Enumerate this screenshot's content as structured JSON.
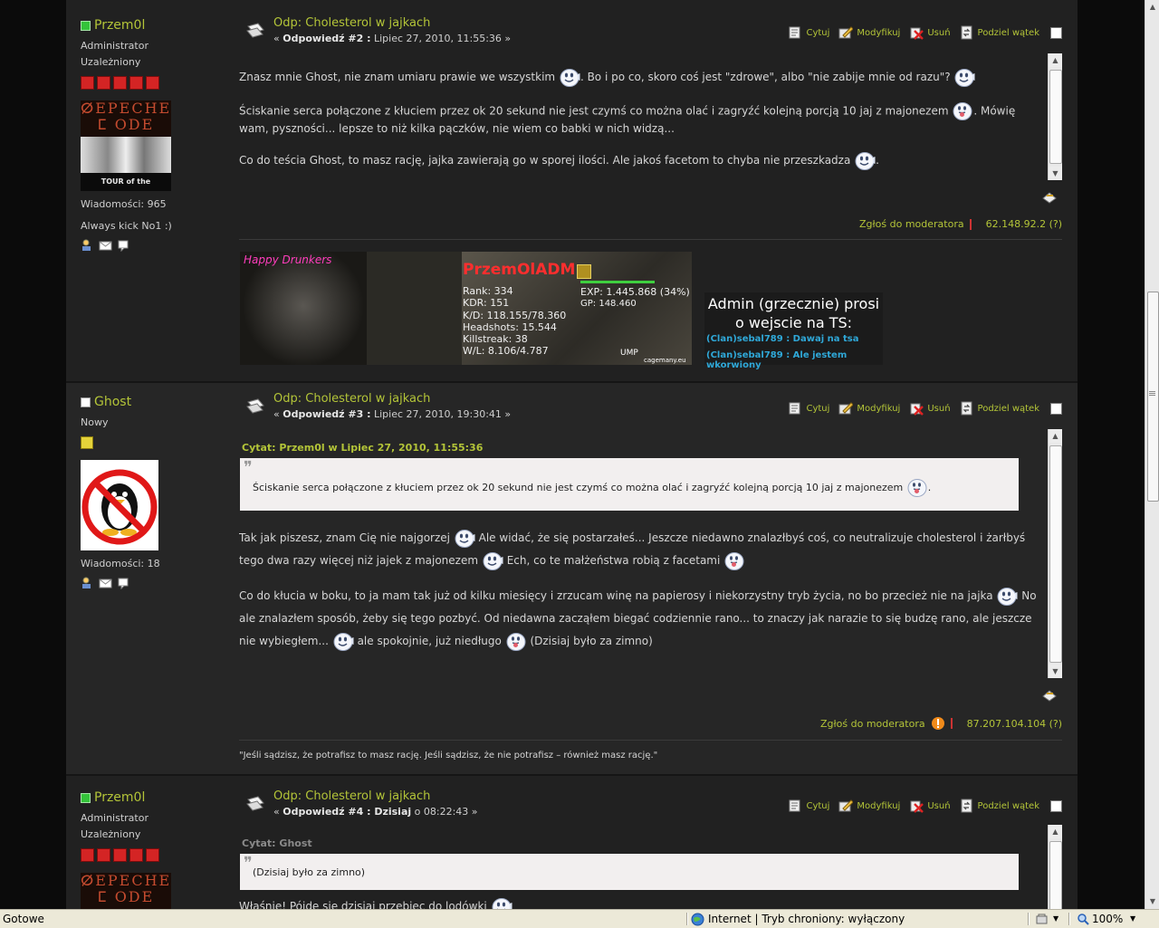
{
  "posts": [
    {
      "username": "Przem0l",
      "online": true,
      "group": "Administrator",
      "rank": "Uzależniony",
      "stars": 5,
      "avatar": {
        "line1": "ⵁEPECHE",
        "line2": "ⵎ ODE",
        "bottom": "TOUR of the UNIVERSE"
      },
      "messages": "Wiadomości: 965",
      "sig_text": "Always kick No1 :)",
      "subject": "Odp: Cholesterol w jajkach",
      "reply_prefix": "« ",
      "reply_num": "Odpowiedź #2 :",
      "reply_date": " Lipiec 27, 2010, 11:55:36 »",
      "body": [
        "Znasz mnie Ghost, nie znam umiaru prawie we wszystkim",
        ". Bo i po co, skoro coś jest \"zdrowe\", albo \"nie zabije mnie od razu\"?",
        "Ściskanie serca połączone z kłuciem przez ok 20 sekund nie jest czymś co można olać i zagryźć kolejną porcją 10 jaj z majonezem",
        ". Mówię wam, pyszności... lepsze to niż kilka pączków, nie wiem co babki w nich widzą...",
        "Co do teścia Ghost, to masz rację, jajka zawierają go w sporej ilości. Ale jakoś facetom to chyba nie przeszkadza",
        "."
      ],
      "report": "Zgłoś do moderatora",
      "ip": "62.148.92.2 (?)",
      "banner": {
        "tag": "Happy Drunkers",
        "name": "PrzemOlADM",
        "stats": [
          "Rank: 334",
          "KDR: 151",
          "K/D: 118.155/78.360",
          "Headshots: 15.544",
          "Killstreak: 38",
          "W/L: 8.106/4.787"
        ],
        "exp": "EXP: 1.445.868 (34%)",
        "gp": "GP: 148.460",
        "site": "cagemany.eu",
        "ump": "UMP"
      },
      "ts": {
        "title": "Admin (grzecznie) prosi o wejscie na TS:",
        "line1": "(Clan)sebal789 : Dawaj na tsa",
        "line2": "(Clan)sebal789 : Ale jestem wkorwiony"
      }
    },
    {
      "username": "Ghost",
      "online": false,
      "rank": "Nowy",
      "messages": "Wiadomości: 18",
      "subject": "Odp: Cholesterol w jajkach",
      "reply_prefix": "« ",
      "reply_num": "Odpowiedź #3 :",
      "reply_date": " Lipiec 27, 2010, 19:30:41 »",
      "quote_head": "Cytat: Przem0l w Lipiec 27, 2010, 11:55:36",
      "quote_text": "Ściskanie serca połączone z kłuciem przez ok 20 sekund nie jest czymś co można olać i zagryźć kolejną porcją 10 jaj z majonezem",
      "quote_end": ".",
      "body": [
        "Tak jak piszesz, znam Cię nie najgorzej",
        " Ale widać, że się postarzałeś... Jeszcze niedawno znalazłbyś coś, co neutralizuje cholesterol i żarłbyś tego dwa razy więcej niż jajek z majonezem",
        " Ech, co te małżeństwa robią z facetami",
        "Co do kłucia w boku, to ja mam tak już od kilku miesięcy i zrzucam winę na papierosy i niekorzystny tryb życia, no bo przecież nie na jajka",
        " No ale znalazłem sposób, żeby się tego pozbyć. Od niedawna zacząłem biegać codziennie rano... to znaczy jak narazie to się budzę rano, ale jeszcze nie wybiegłem...",
        " ale spokojnie, już niedługo",
        " (Dzisiaj było za zimno)"
      ],
      "report": "Zgłoś do moderatora",
      "ip": "87.207.104.104 (?)",
      "signature": "\"Jeśli sądzisz, że potrafisz to masz rację. Jeśli sądzisz, że nie potrafisz – również masz rację.\""
    },
    {
      "username": "Przem0l",
      "online": true,
      "group": "Administrator",
      "rank": "Uzależniony",
      "stars": 5,
      "avatar": {
        "line1": "ⵁEPECHE",
        "line2": "ⵎ ODE"
      },
      "subject": "Odp: Cholesterol w jajkach",
      "reply_prefix": "« ",
      "reply_num": "Odpowiedź #4 :",
      "reply_today": " Dzisiaj",
      "reply_date": " o 08:22:43 »",
      "quote_head": "Cytat: Ghost",
      "quote_text": "(Dzisiaj było za zimno)",
      "partial": "Właśnie! Pójdę się dzisiaj przebiec do lodówki"
    }
  ],
  "tools": {
    "quote": "Cytuj",
    "modify": "Modyfikuj",
    "remove": "Usuń",
    "split": "Podziel wątek"
  },
  "statusbar": {
    "status": "Gotowe",
    "zone": "Internet | Tryb chroniony: wyłączony",
    "zoom": "100%"
  },
  "colors": {
    "accent": "#b3c438",
    "background": "#212121",
    "alt_background": "#262626"
  }
}
